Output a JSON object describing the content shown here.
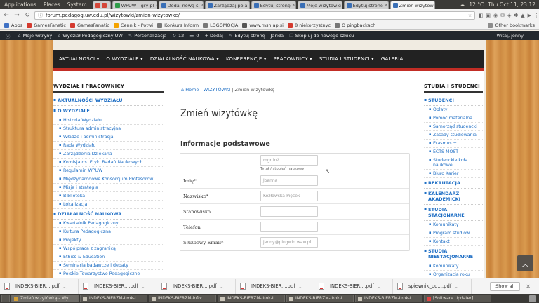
{
  "panel": {
    "applications": "Applications",
    "places": "Places",
    "system": "System",
    "temperature": "12 °C",
    "clock": "Thu Oct 11, 23:12"
  },
  "tabs": [
    {
      "label": "WPUW - gry pl",
      "fav": "#2e9c48",
      "active": false
    },
    {
      "label": "Dodaj nową sl",
      "fav": "#3a6fb6",
      "active": false
    },
    {
      "label": "Zarządzaj pola",
      "fav": "#3a6fb6",
      "active": false
    },
    {
      "label": "Edytuj stronę",
      "fav": "#3a6fb6",
      "active": false
    },
    {
      "label": "Moje wizytówki",
      "fav": "#3a6fb6",
      "active": false
    },
    {
      "label": "Edytuj stronę",
      "fav": "#3a6fb6",
      "active": false
    },
    {
      "label": "Zmień wizytów",
      "fav": "#3a6fb6",
      "active": true
    }
  ],
  "tray_user": "Jenny",
  "omnibox": {
    "url": "forum.pedagog.uw.edu.pl/wizytowki/zmien-wizytowke/"
  },
  "bookmarks": {
    "apps": "Apps",
    "items": [
      {
        "label": "GamesFanatic",
        "color": "#d43a2f"
      },
      {
        "label": "GamesFanatic",
        "color": "#d43a2f"
      },
      {
        "label": "Cennik - Potwi",
        "color": "#f4a300"
      },
      {
        "label": "Konkurs Inform",
        "color": "#777777"
      },
      {
        "label": "LOGOMOCJA",
        "color": "#777777"
      },
      {
        "label": "www.msn.ap.si",
        "color": "#555555"
      },
      {
        "label": "8 niekorzystnyc",
        "color": "#d43a2f"
      },
      {
        "label": "O pingbackach",
        "color": "#777777"
      }
    ],
    "other": "Other bookmarks"
  },
  "adminbar": {
    "my_sites": "Moje witryny",
    "site_name": "Wydział Pedagogiczny UW",
    "customize": "Personalizacja",
    "updates_count": "12",
    "comments_count": "0",
    "new": "+ Dodaj",
    "edit_page": "Edytuj stronę",
    "jarida": "Jarida",
    "copy_draft": "Skopiuj do nowego szkicu",
    "greeting": "Witaj, jenny"
  },
  "main_nav": [
    "AKTUALNOŚCI ▾",
    "O WYDZIALE ▾",
    "DZIAŁALNOŚĆ NAUKOWA ▾",
    "KONFERENCJE ▾",
    "PRACOWNICY ▾",
    "STUDIA I STUDENCI ▾",
    "GALERIA"
  ],
  "left_sidebar": {
    "title": "WYDZIAŁ I PRACOWNICY",
    "sections": [
      {
        "label": "AKTUALNOŚCI WYDZIAŁU",
        "items": []
      },
      {
        "label": "O WYDZIALE",
        "items": [
          "Historia Wydziału",
          "Struktura administracyjna",
          "Władze i administracja",
          "Rada Wydziału",
          "Zarządzenia Dziekana",
          "Komisja ds. Etyki Badań Naukowych",
          "Regulamin WPUW",
          "Międzynarodowe Konsorcjum Profesorów",
          "Misja i strategia",
          "Biblioteka",
          "Lokalizacja"
        ]
      },
      {
        "label": "DZIAŁALNOŚĆ NAUKOWA",
        "items": [
          "Kwartalnik Pedagogiczny",
          "Kultura Pedagogiczna",
          "Projekty",
          "Współpraca z zagranicą",
          "Ethics & Education",
          "Seminaria badawcze i debaty",
          "Polskie Towarzystwo Pedagogiczne",
          "Towarzystwo Historii Edukacji"
        ]
      }
    ]
  },
  "right_sidebar": {
    "title": "STUDIA I STUDENCI",
    "sections": [
      {
        "label": "STUDENCI",
        "items": [
          "Opłaty",
          "Pomoc materialna",
          "Samorząd studencki",
          "Zasady studiowania",
          "Erasmus +",
          "ECTS-MOST",
          "Studenckie koła naukowe",
          "Biuro Karier"
        ]
      },
      {
        "label": "REKRUTACJA",
        "items": []
      },
      {
        "label": "KALENDARZ AKADEMICKI",
        "items": []
      },
      {
        "label": "STUDIA STACJONARNE",
        "items": [
          "Komunikaty",
          "Program studiów",
          "Kontakt"
        ]
      },
      {
        "label": "STUDIA NIESTACJONARNE",
        "items": [
          "Komunikaty",
          "Organizacja roku"
        ]
      }
    ]
  },
  "breadcrumb": {
    "home": "Home",
    "sep1": " | ",
    "parent": "WIZYTÓWKI",
    "sep2": " | ",
    "current": "Zmień wizytówkę"
  },
  "page_title": "Zmień wizytówkę",
  "form": {
    "section_title": "Informacje podstawowe",
    "title_placeholder": "mgr inż.",
    "title_hint": "Tytuł / stopień naukowy",
    "first_name_label": "Imię*",
    "first_name_value": "Joanna",
    "last_name_label": "Nazwisko*",
    "last_name_value": "Kozłowska-Pięcek",
    "position_label": "Stanowisko",
    "position_value": "",
    "phone_label": "Telefon",
    "phone_value": "",
    "email_label": "Służbowy Email*",
    "email_value": "jenny@pingwin.waw.pl"
  },
  "downloads": {
    "files": [
      "INDEKS-BIER....pdf",
      "INDEKS-BIER....pdf",
      "INDEKS-BIER....pdf",
      "INDEKS-BIER....pdf",
      "INDEKS-BIER....pdf",
      "spiewnik_od....pdf"
    ],
    "show_all": "Show all"
  },
  "taskbar": [
    {
      "label": "Zmień wizytówkę – Wy...",
      "active": true
    },
    {
      "label": "INDEKS-BIERZM-IIrok-I...",
      "active": false
    },
    {
      "label": "INDEKS-BIERZM-infor...",
      "active": false
    },
    {
      "label": "INDEKS-BIERZM-IIrok-I...",
      "active": false
    },
    {
      "label": "INDEKS-BIERZM-IIrok-I...",
      "active": false
    },
    {
      "label": "INDEKS-BIERZM-IIrok-I...",
      "active": false
    },
    {
      "label": "[Software Updater]",
      "active": false
    }
  ]
}
